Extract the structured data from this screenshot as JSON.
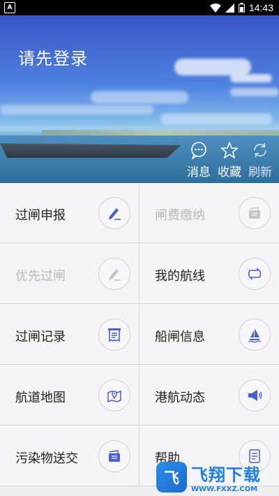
{
  "status_bar": {
    "time": "14:43"
  },
  "header": {
    "login_prompt": "请先登录"
  },
  "actions": [
    {
      "label": "消息",
      "icon": "chat-bubble-icon"
    },
    {
      "label": "收藏",
      "icon": "star-icon"
    },
    {
      "label": "刷新",
      "icon": "refresh-icon"
    }
  ],
  "menu": [
    {
      "label": "过闸申报",
      "icon": "pen-icon",
      "enabled": true
    },
    {
      "label": "闸费缴纳",
      "icon": "card-icon",
      "enabled": false
    },
    {
      "label": "优先过闸",
      "icon": "pen-icon",
      "enabled": false
    },
    {
      "label": "我的航线",
      "icon": "route-icon",
      "enabled": true
    },
    {
      "label": "过闸记录",
      "icon": "receipt-icon",
      "enabled": true
    },
    {
      "label": "船闸信息",
      "icon": "sailboat-icon",
      "enabled": true
    },
    {
      "label": "航道地图",
      "icon": "map-pin-icon",
      "enabled": true
    },
    {
      "label": "港航动态",
      "icon": "megaphone-icon",
      "enabled": true
    },
    {
      "label": "污染物送交",
      "icon": "card-icon",
      "enabled": true
    },
    {
      "label": "帮助",
      "icon": "document-icon",
      "enabled": true
    }
  ],
  "watermark": {
    "logo_text": "飞",
    "text": "飞翔下载",
    "url": "WWW.FXXZ.COM"
  },
  "colors": {
    "accent": "#4a5fd0",
    "disabled": "#b8b8b8"
  }
}
